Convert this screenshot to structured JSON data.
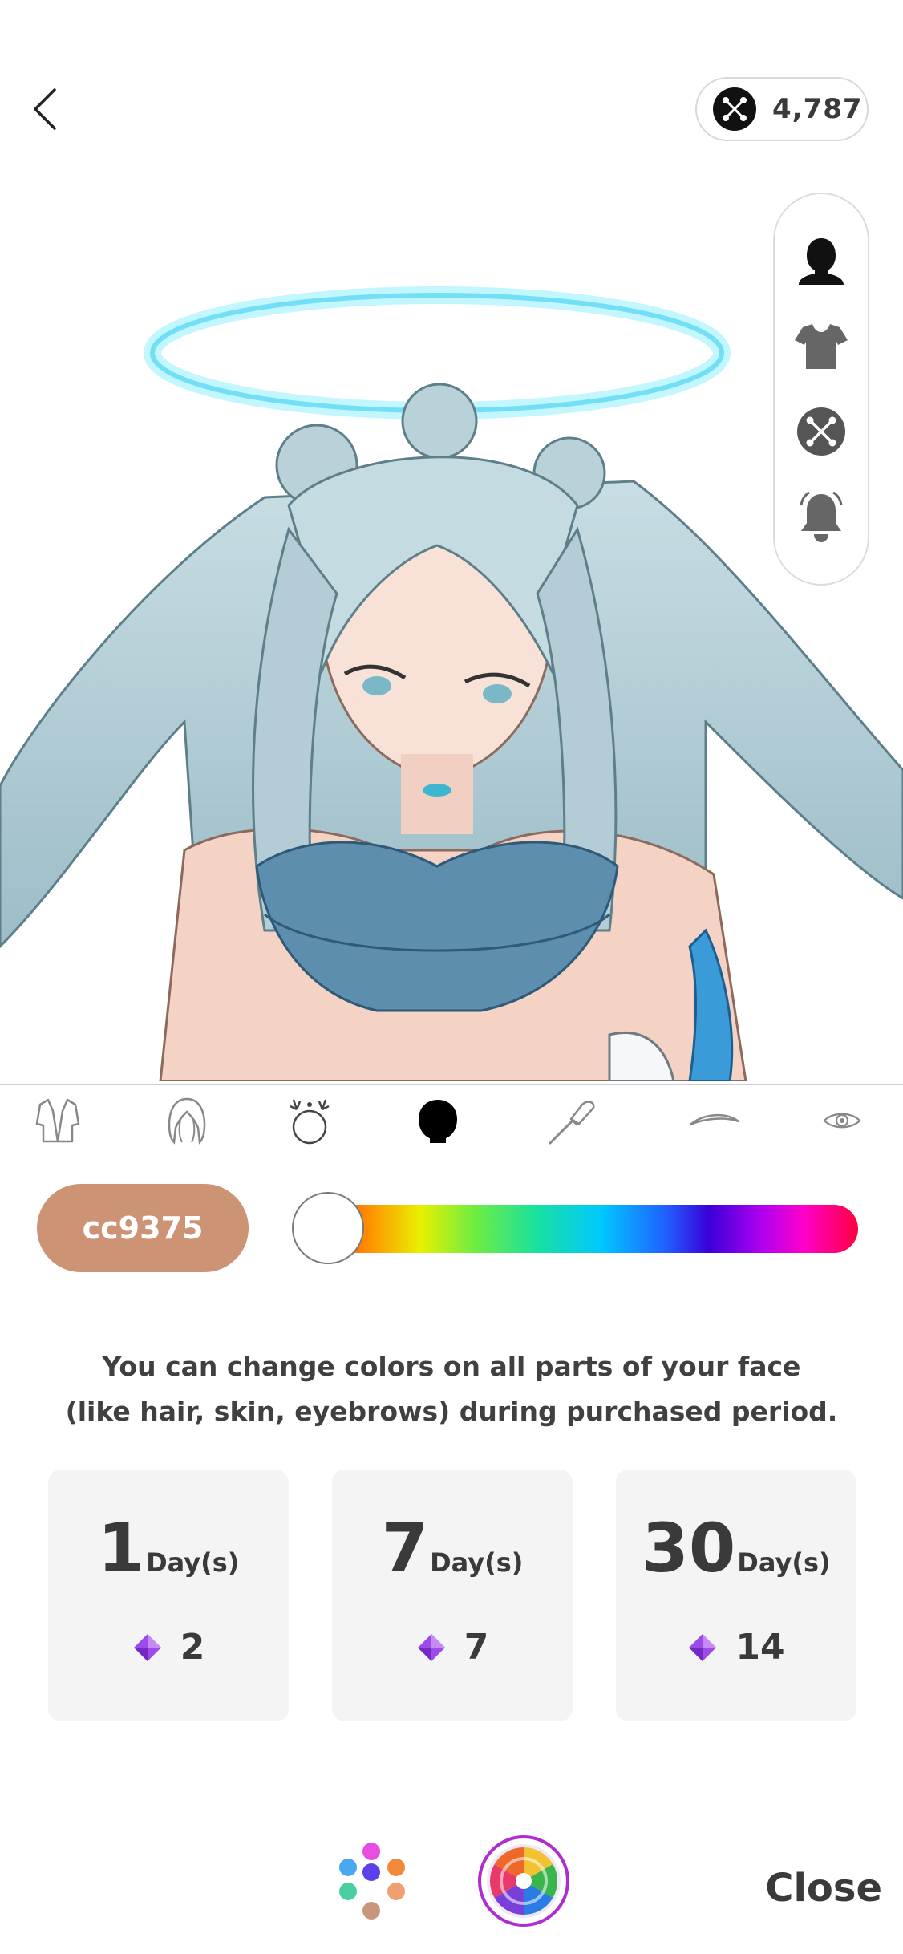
{
  "header": {
    "back_icon": "chevron-left-icon",
    "coin_icon": "crossed-tools-icon",
    "coin_amount": "4,787"
  },
  "side_menu": {
    "items": [
      {
        "icon": "face-silhouette-icon"
      },
      {
        "icon": "tshirt-icon"
      },
      {
        "icon": "crossed-tools-icon"
      },
      {
        "icon": "bell-icon"
      }
    ]
  },
  "parts_tabs": {
    "items": [
      {
        "icon": "outfit-icon"
      },
      {
        "icon": "hair-icon"
      },
      {
        "icon": "accessory-icon"
      },
      {
        "icon": "face-icon",
        "selected": true
      },
      {
        "icon": "makeup-brush-icon"
      },
      {
        "icon": "eyebrow-icon"
      },
      {
        "icon": "eye-icon"
      }
    ]
  },
  "color": {
    "hex_label": "cc9375",
    "hex_value": "#cc9375",
    "slider_position": 0.0
  },
  "description": {
    "line1": "You can change colors on all parts of your face",
    "line2": "(like hair, skin, eyebrows) during purchased period."
  },
  "plans": [
    {
      "number": "1",
      "unit": "Day(s)",
      "price": "2"
    },
    {
      "number": "7",
      "unit": "Day(s)",
      "price": "7"
    },
    {
      "number": "30",
      "unit": "Day(s)",
      "price": "14"
    }
  ],
  "bottom_bar": {
    "palette_icon": "palette-dots-icon",
    "wheel_icon": "color-wheel-icon",
    "close_label": "Close"
  },
  "colors": {
    "accent_purple": "#b02cd0",
    "gem_purple": "#8a3ee0",
    "text_dark": "#3a3a3a"
  }
}
